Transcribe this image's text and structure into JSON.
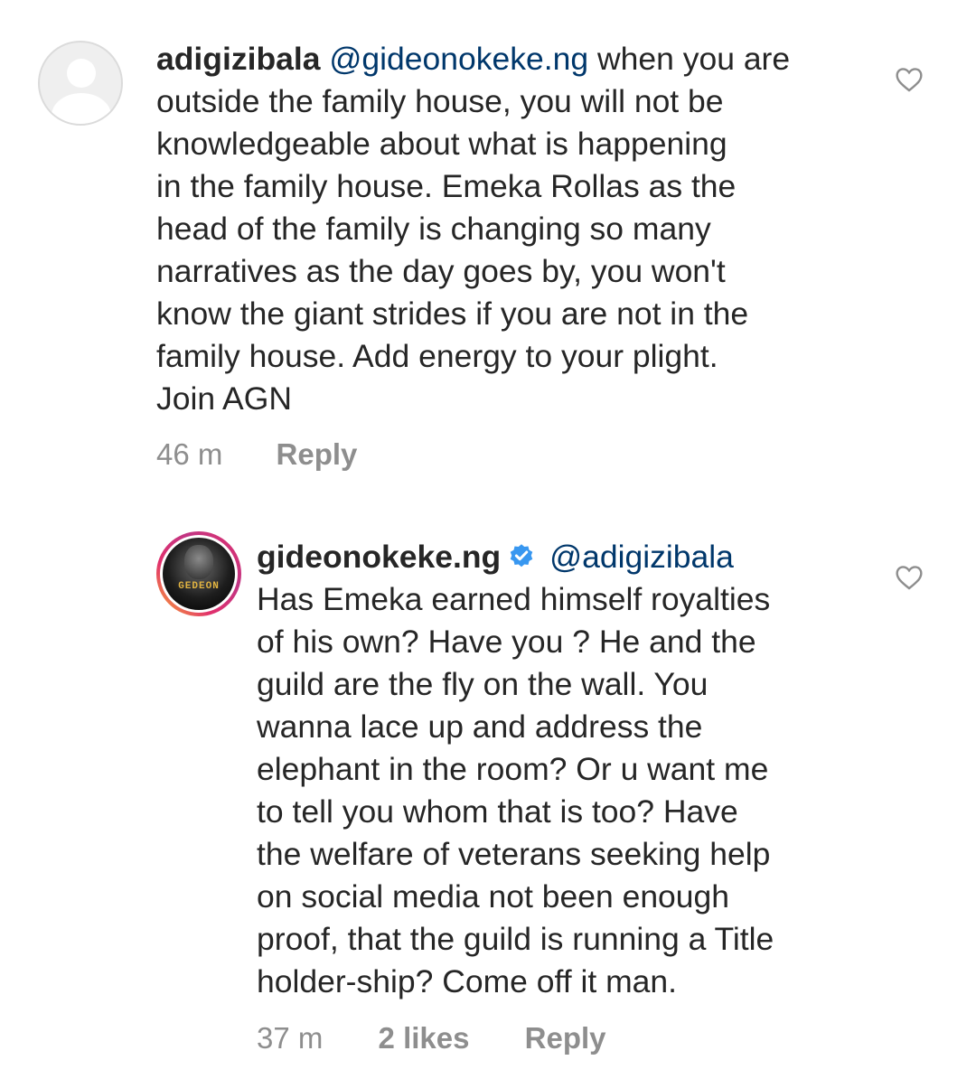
{
  "comments": [
    {
      "username": "adigizibala",
      "avatar_icon": "default-profile-icon",
      "mention": "@gideonokeke.ng",
      "lines": [
        "when you are",
        "outside the family house, you will not be",
        "knowledgeable about what is happening",
        "in the family house. Emeka Rollas as the",
        "head of the family is changing so many",
        "narratives as the day goes by, you won't",
        "know the giant strides if you are not in the",
        "family house. Add energy to your plight.",
        "Join AGN"
      ],
      "time": "46 m",
      "reply_label": "Reply",
      "like_icon": "heart-outline-icon"
    },
    {
      "username": "gideonokeke.ng",
      "verified_icon": "verified-badge-icon",
      "avatar_brand_text": "GEDEON",
      "mention": "@adigizibala",
      "lines": [
        "Has Emeka earned himself royalties",
        "of his own? Have you ? He and the",
        "guild are the fly on the wall. You",
        "wanna lace up and address the",
        "elephant in the room? Or u want me",
        "to tell you whom that is too? Have",
        "the welfare of veterans seeking help",
        "on social media not been enough",
        "proof, that the guild is running a Title",
        "holder-ship? Come off it man."
      ],
      "time": "37 m",
      "likes_label": "2 likes",
      "reply_label": "Reply",
      "like_icon": "heart-outline-icon"
    }
  ],
  "colors": {
    "text": "#262626",
    "mention": "#00376b",
    "meta": "#8e8e8e",
    "verified": "#3897f0"
  }
}
